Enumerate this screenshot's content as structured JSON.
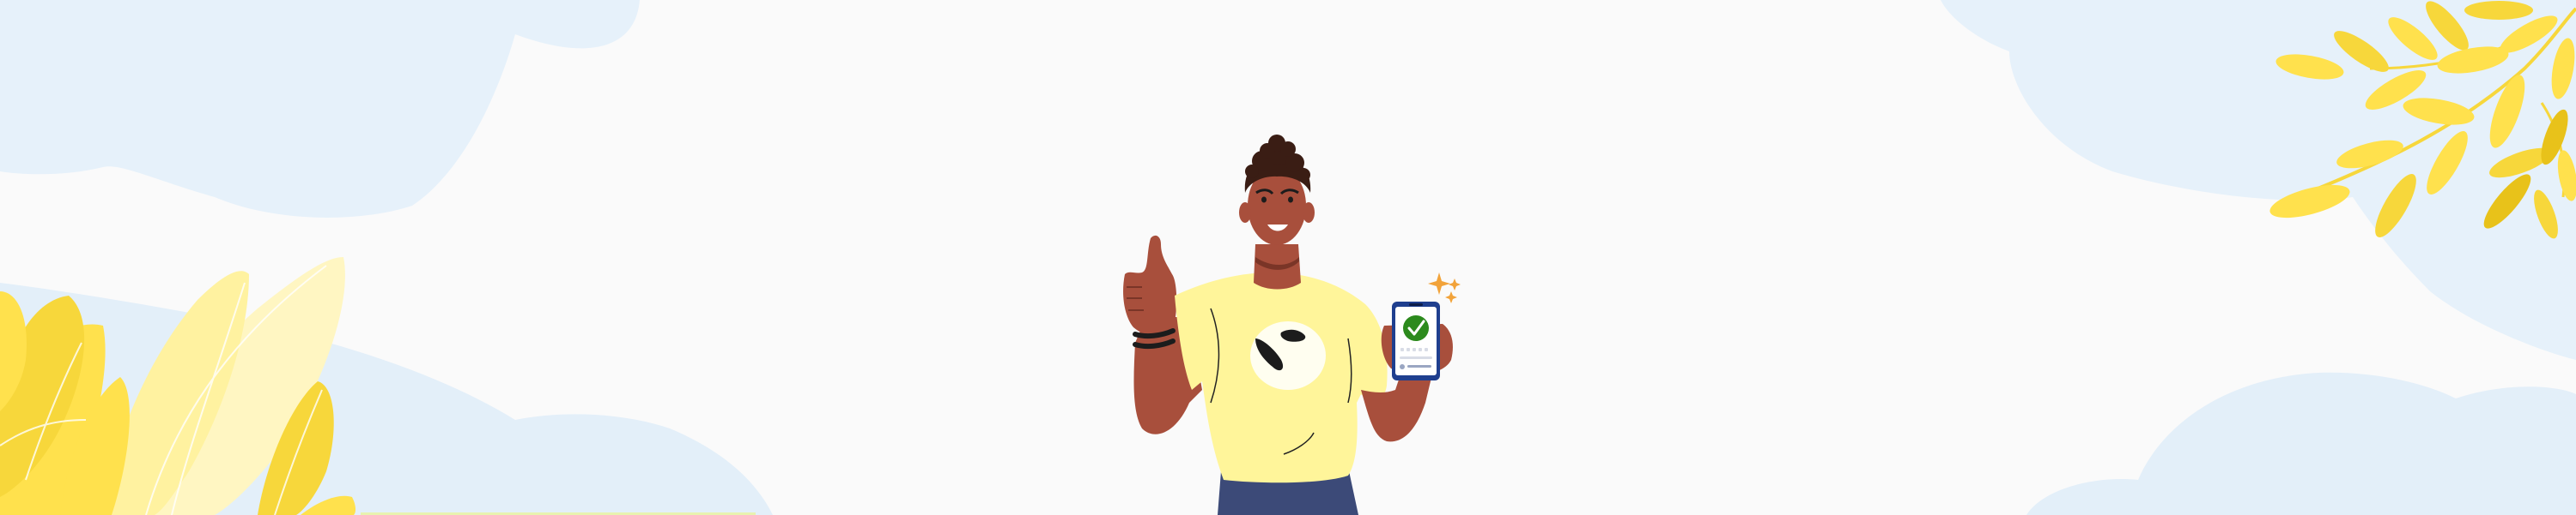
{
  "scene": {
    "background_color": "#fafafa",
    "cloud_color": "#e6f1fa",
    "foliage_colors": [
      "#ffe14d",
      "#f7d73b",
      "#fff2a0",
      "#fff6c2",
      "#e8c21a"
    ],
    "person": {
      "skin_color": "#a84f3c",
      "hair_color": "#3a1d14",
      "shirt_color": "#fff59a",
      "pants_color": "#3c4a78",
      "gesture": "thumbs-up"
    },
    "phone": {
      "frame_color": "#1f3f8f",
      "screen_color": "#ffffff",
      "check_color": "#2c8a1d",
      "sparkle_color": "#f2a33a",
      "status": "verified"
    }
  }
}
